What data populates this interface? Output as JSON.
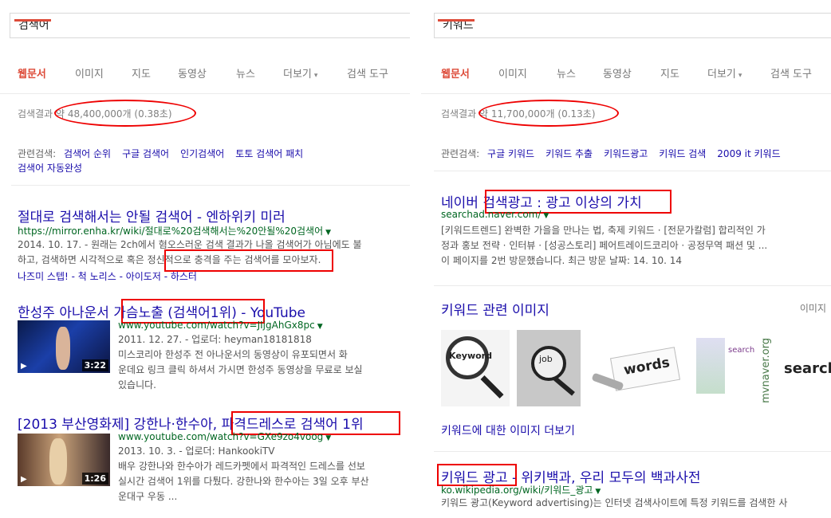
{
  "left": {
    "search_query": "검색어",
    "tabs": [
      "웹문서",
      "이미지",
      "지도",
      "동영상",
      "뉴스",
      "더보기",
      "검색 도구"
    ],
    "more_arrow": "▾",
    "stats_prefix": "검색결과 약",
    "stats_value": "48,400,000개 (0.38초)",
    "related": {
      "label": "관련검색:",
      "items": [
        "검색어 순위",
        "구글 검색어",
        "인기검색어",
        "토토 검색어 패치",
        "검색어 자동완성"
      ]
    },
    "results": [
      {
        "title": "절대로 검색해서는 안될 검색어 - 엔하위키 미러",
        "url": "https://mirror.enha.kr/wiki/절대로%20검색해서는%20안될%20검색어",
        "snippet_lines": [
          "2014. 10. 17. - 원래는 2ch에서 혐오스러운 검색 결과가 나올 검색어가 아님에도 불",
          "하고, 검색하면 시각적으로 혹은 정신적으로 충격을 주는 검색어를 모아보자."
        ],
        "sublinks": "나즈미 스텝! - 척 노리스 - 아이도저 - 하스터"
      },
      {
        "title": "한성주 아나운서 가슴노출 (검색어1위) - YouTube",
        "url": "www.youtube.com/watch?v=JIjgAhGx8pc",
        "meta": "2011. 12. 27. - 업로더: heyman18181818",
        "snippet_lines": [
          "미스코리아 한성주 전 아나운서의 동영상이 유포되면서 화",
          "운데요 링크 클릭 하셔서 가시면 한성주 동영상을 무료로 보실",
          "있습니다."
        ],
        "duration": "3:22"
      },
      {
        "title": "[2013 부산영화제] 강한나·한수아, 파격드레스로 검색어 1위",
        "url": "www.youtube.com/watch?v=GXe9zo4voog",
        "meta": "2013. 10. 3. - 업로더: HankookiTV",
        "snippet_lines": [
          "배우 강한나와 한수아가 레드카펫에서 파격적인 드레스를 선보",
          "실시간 검색어 1위를 다퉜다. 강한나와 한수아는 3일 오후 부산",
          "운대구 우동 ..."
        ],
        "duration": "1:26"
      }
    ]
  },
  "right": {
    "search_query": "키워드",
    "tabs": [
      "웹문서",
      "이미지",
      "뉴스",
      "동영상",
      "지도",
      "더보기",
      "검색 도구"
    ],
    "more_arrow": "▾",
    "stats_prefix": "검색결과 약",
    "stats_value": "11,700,000개 (0.13초)",
    "related": {
      "label": "관련검색:",
      "items": [
        "구글 키워드",
        "키워드 추출",
        "키워드광고",
        "키워드 검색",
        "2009 it 키워드"
      ]
    },
    "results": [
      {
        "title": "네이버 검색광고 : 광고 이상의 가치",
        "url": "searchad.naver.com/",
        "snippet_lines": [
          "[키워드트렌드] 완벽한 가을을 만나는 법, 축제 키워드 · [전문가칼럼] 합리적인 가",
          "정과 홍보 전략 · 인터뷰 · [성공스토리] 페어트레이드코리아 · 공정무역 패션 및 ...",
          "이 페이지를 2번 방문했습니다. 최근 방문 날짜: 14. 10. 14"
        ]
      },
      {
        "title": "키워드 광고 - 위키백과, 우리 모두의 백과사전",
        "url": "ko.wikipedia.org/wiki/키워드_광고",
        "snippet_lines": [
          "키워드 광고(Keyword advertising)는 인터넷 검색사이트에 특정 키워드를 검색한 사"
        ]
      }
    ],
    "images": {
      "heading": "키워드 관련 이미지",
      "report": "이미지",
      "more": "키워드에 대한 이미지 더보기",
      "tile_texts": [
        "Keyword",
        "job",
        "words",
        "search",
        "mvnaver.org",
        "search"
      ]
    }
  }
}
